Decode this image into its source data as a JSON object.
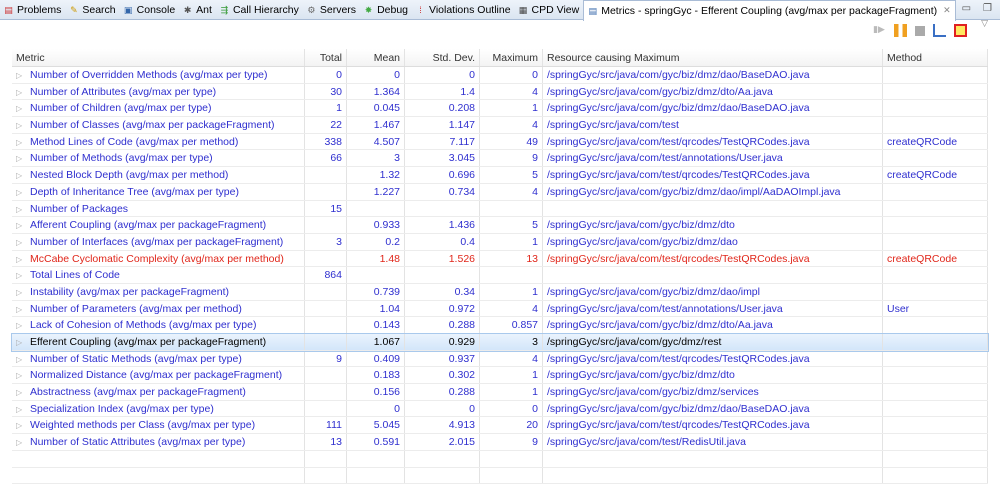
{
  "tabs": [
    {
      "label": "Problems",
      "icon": "problems-icon"
    },
    {
      "label": "Search",
      "icon": "search-icon"
    },
    {
      "label": "Console",
      "icon": "console-icon"
    },
    {
      "label": "Ant",
      "icon": "ant-icon"
    },
    {
      "label": "Call Hierarchy",
      "icon": "call-hierarchy-icon"
    },
    {
      "label": "Servers",
      "icon": "servers-icon"
    },
    {
      "label": "Debug",
      "icon": "debug-icon"
    },
    {
      "label": "Violations Outline",
      "icon": "violations-icon"
    },
    {
      "label": "CPD View",
      "icon": "cpd-icon"
    }
  ],
  "active_tab": {
    "label": "Metrics - springGyc - Efferent Coupling (avg/max per packageFragment)",
    "icon": "metrics-icon"
  },
  "columns": [
    "Metric",
    "Total",
    "Mean",
    "Std. Dev.",
    "Maximum",
    "Resource causing Maximum",
    "Method"
  ],
  "rows": [
    [
      "Number of Overridden Methods (avg/max per type)",
      "0",
      "0",
      "0",
      "0",
      "/springGyc/src/java/com/gyc/biz/dmz/dao/BaseDAO.java",
      ""
    ],
    [
      "Number of Attributes (avg/max per type)",
      "30",
      "1.364",
      "1.4",
      "4",
      "/springGyc/src/java/com/gyc/biz/dmz/dto/Aa.java",
      ""
    ],
    [
      "Number of Children (avg/max per type)",
      "1",
      "0.045",
      "0.208",
      "1",
      "/springGyc/src/java/com/gyc/biz/dmz/dao/BaseDAO.java",
      ""
    ],
    [
      "Number of Classes (avg/max per packageFragment)",
      "22",
      "1.467",
      "1.147",
      "4",
      "/springGyc/src/java/com/test",
      ""
    ],
    [
      "Method Lines of Code (avg/max per method)",
      "338",
      "4.507",
      "7.117",
      "49",
      "/springGyc/src/java/com/test/qrcodes/TestQRCodes.java",
      "createQRCode"
    ],
    [
      "Number of Methods (avg/max per type)",
      "66",
      "3",
      "3.045",
      "9",
      "/springGyc/src/java/com/test/annotations/User.java",
      ""
    ],
    [
      "Nested Block Depth (avg/max per method)",
      "",
      "1.32",
      "0.696",
      "5",
      "/springGyc/src/java/com/test/qrcodes/TestQRCodes.java",
      "createQRCode"
    ],
    [
      "Depth of Inheritance Tree (avg/max per type)",
      "",
      "1.227",
      "0.734",
      "4",
      "/springGyc/src/java/com/gyc/biz/dmz/dao/impl/AaDAOImpl.java",
      ""
    ],
    [
      "Number of Packages",
      "15",
      "",
      "",
      "",
      "",
      ""
    ],
    [
      "Afferent Coupling (avg/max per packageFragment)",
      "",
      "0.933",
      "1.436",
      "5",
      "/springGyc/src/java/com/gyc/biz/dmz/dto",
      ""
    ],
    [
      "Number of Interfaces (avg/max per packageFragment)",
      "3",
      "0.2",
      "0.4",
      "1",
      "/springGyc/src/java/com/gyc/biz/dmz/dao",
      ""
    ],
    [
      "McCabe Cyclomatic Complexity (avg/max per method)",
      "",
      "1.48",
      "1.526",
      "13",
      "/springGyc/src/java/com/test/qrcodes/TestQRCodes.java",
      "createQRCode"
    ],
    [
      "Total Lines of Code",
      "864",
      "",
      "",
      "",
      "",
      ""
    ],
    [
      "Instability (avg/max per packageFragment)",
      "",
      "0.739",
      "0.34",
      "1",
      "/springGyc/src/java/com/gyc/biz/dmz/dao/impl",
      ""
    ],
    [
      "Number of Parameters (avg/max per method)",
      "",
      "1.04",
      "0.972",
      "4",
      "/springGyc/src/java/com/test/annotations/User.java",
      "User"
    ],
    [
      "Lack of Cohesion of Methods (avg/max per type)",
      "",
      "0.143",
      "0.288",
      "0.857",
      "/springGyc/src/java/com/gyc/biz/dmz/dto/Aa.java",
      ""
    ],
    [
      "Efferent Coupling (avg/max per packageFragment)",
      "",
      "1.067",
      "0.929",
      "3",
      "/springGyc/src/java/com/gyc/dmz/rest",
      ""
    ],
    [
      "Number of Static Methods (avg/max per type)",
      "9",
      "0.409",
      "0.937",
      "4",
      "/springGyc/src/java/com/test/qrcodes/TestQRCodes.java",
      ""
    ],
    [
      "Normalized Distance (avg/max per packageFragment)",
      "",
      "0.183",
      "0.302",
      "1",
      "/springGyc/src/java/com/gyc/biz/dmz/dto",
      ""
    ],
    [
      "Abstractness (avg/max per packageFragment)",
      "",
      "0.156",
      "0.288",
      "1",
      "/springGyc/src/java/com/gyc/biz/dmz/services",
      ""
    ],
    [
      "Specialization Index (avg/max per type)",
      "",
      "0",
      "0",
      "0",
      "/springGyc/src/java/com/gyc/biz/dmz/dao/BaseDAO.java",
      ""
    ],
    [
      "Weighted methods per Class (avg/max per type)",
      "111",
      "5.045",
      "4.913",
      "20",
      "/springGyc/src/java/com/test/qrcodes/TestQRCodes.java",
      ""
    ],
    [
      "Number of Static Attributes (avg/max per type)",
      "13",
      "0.591",
      "2.015",
      "9",
      "/springGyc/src/java/com/test/RedisUtil.java",
      ""
    ]
  ],
  "selected_row": 16,
  "red_row": 11,
  "colors": {
    "link": "#2f2fcf",
    "warning": "#e0261a",
    "selection": "#d3e6fa"
  }
}
